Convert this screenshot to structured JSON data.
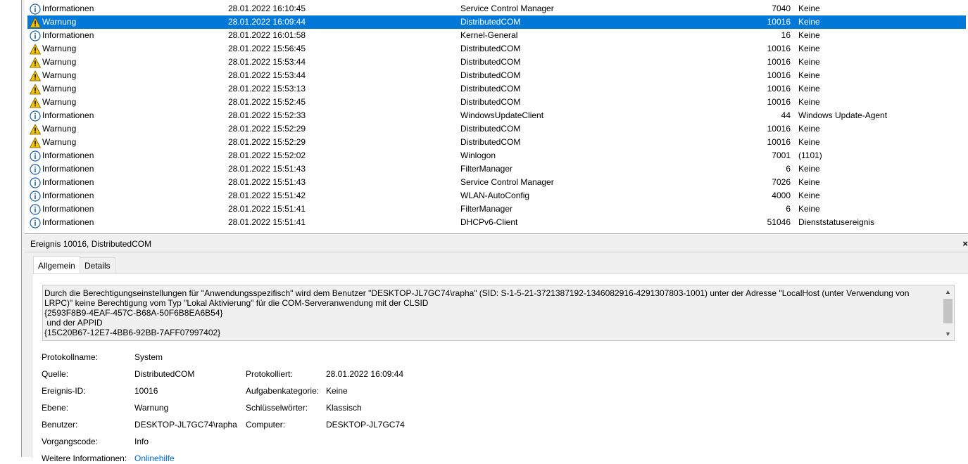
{
  "events": [
    {
      "level": "Informationen",
      "icon": "info",
      "date": "28.01.2022 16:10:45",
      "source": "Service Control Manager",
      "id": "7040",
      "category": "Keine",
      "selected": false
    },
    {
      "level": "Warnung",
      "icon": "warning",
      "date": "28.01.2022 16:09:44",
      "source": "DistributedCOM",
      "id": "10016",
      "category": "Keine",
      "selected": true
    },
    {
      "level": "Informationen",
      "icon": "info",
      "date": "28.01.2022 16:01:58",
      "source": "Kernel-General",
      "id": "16",
      "category": "Keine",
      "selected": false
    },
    {
      "level": "Warnung",
      "icon": "warning",
      "date": "28.01.2022 15:56:45",
      "source": "DistributedCOM",
      "id": "10016",
      "category": "Keine",
      "selected": false
    },
    {
      "level": "Warnung",
      "icon": "warning",
      "date": "28.01.2022 15:53:44",
      "source": "DistributedCOM",
      "id": "10016",
      "category": "Keine",
      "selected": false
    },
    {
      "level": "Warnung",
      "icon": "warning",
      "date": "28.01.2022 15:53:44",
      "source": "DistributedCOM",
      "id": "10016",
      "category": "Keine",
      "selected": false
    },
    {
      "level": "Warnung",
      "icon": "warning",
      "date": "28.01.2022 15:53:13",
      "source": "DistributedCOM",
      "id": "10016",
      "category": "Keine",
      "selected": false
    },
    {
      "level": "Warnung",
      "icon": "warning",
      "date": "28.01.2022 15:52:45",
      "source": "DistributedCOM",
      "id": "10016",
      "category": "Keine",
      "selected": false
    },
    {
      "level": "Informationen",
      "icon": "info",
      "date": "28.01.2022 15:52:33",
      "source": "WindowsUpdateClient",
      "id": "44",
      "category": "Windows Update-Agent",
      "selected": false
    },
    {
      "level": "Warnung",
      "icon": "warning",
      "date": "28.01.2022 15:52:29",
      "source": "DistributedCOM",
      "id": "10016",
      "category": "Keine",
      "selected": false
    },
    {
      "level": "Warnung",
      "icon": "warning",
      "date": "28.01.2022 15:52:29",
      "source": "DistributedCOM",
      "id": "10016",
      "category": "Keine",
      "selected": false
    },
    {
      "level": "Informationen",
      "icon": "info",
      "date": "28.01.2022 15:52:02",
      "source": "Winlogon",
      "id": "7001",
      "category": "(1101)",
      "selected": false
    },
    {
      "level": "Informationen",
      "icon": "info",
      "date": "28.01.2022 15:51:43",
      "source": "FilterManager",
      "id": "6",
      "category": "Keine",
      "selected": false
    },
    {
      "level": "Informationen",
      "icon": "info",
      "date": "28.01.2022 15:51:43",
      "source": "Service Control Manager",
      "id": "7026",
      "category": "Keine",
      "selected": false
    },
    {
      "level": "Informationen",
      "icon": "info",
      "date": "28.01.2022 15:51:42",
      "source": "WLAN-AutoConfig",
      "id": "4000",
      "category": "Keine",
      "selected": false
    },
    {
      "level": "Informationen",
      "icon": "info",
      "date": "28.01.2022 15:51:41",
      "source": "FilterManager",
      "id": "6",
      "category": "Keine",
      "selected": false
    },
    {
      "level": "Informationen",
      "icon": "info",
      "date": "28.01.2022 15:51:41",
      "source": "DHCPv6-Client",
      "id": "51046",
      "category": "Dienststatusereignis",
      "selected": false
    }
  ],
  "details": {
    "title": "Ereignis 10016, DistributedCOM",
    "close_label": "×",
    "tabs": [
      {
        "label": "Allgemein",
        "active": true
      },
      {
        "label": "Details",
        "active": false
      }
    ],
    "message": "Durch die Berechtigungseinstellungen für \"Anwendungsspezifisch\" wird dem Benutzer \"DESKTOP-JL7GC74\\rapha\" (SID: S-1-5-21-3721387192-1346082916-4291307803-1001) unter der Adresse \"LocalHost (unter Verwendung von LRPC)\" keine Berechtigung vom Typ \"Lokal Aktivierung\" für die COM-Serveranwendung mit der CLSID\n{2593F8B9-4EAF-457C-B68A-50F6B8EA6B54}\n und der APPID\n{15C20B67-12E7-4BB6-92BB-7AFF07997402}",
    "props": {
      "protokollname_label": "Protokollname:",
      "protokollname": "System",
      "quelle_label": "Quelle:",
      "quelle": "DistributedCOM",
      "protokolliert_label": "Protokolliert:",
      "protokolliert": "28.01.2022 16:09:44",
      "ereignis_id_label": "Ereignis-ID:",
      "ereignis_id": "10016",
      "aufgabenkategorie_label": "Aufgabenkategorie:",
      "aufgabenkategorie": "Keine",
      "ebene_label": "Ebene:",
      "ebene": "Warnung",
      "schluesselwoerter_label": "Schlüsselwörter:",
      "schluesselwoerter": "Klassisch",
      "benutzer_label": "Benutzer:",
      "benutzer": "DESKTOP-JL7GC74\\rapha",
      "computer_label": "Computer:",
      "computer": "DESKTOP-JL7GC74",
      "vorgangscode_label": "Vorgangscode:",
      "vorgangscode": "Info",
      "weitere_label": "Weitere Informationen:",
      "weitere_link": "Onlinehilfe"
    }
  },
  "colors": {
    "selection": "#0078d7",
    "info_icon": "#1c5fa8",
    "warning_fill": "#f5c400",
    "link": "#0066cc"
  }
}
